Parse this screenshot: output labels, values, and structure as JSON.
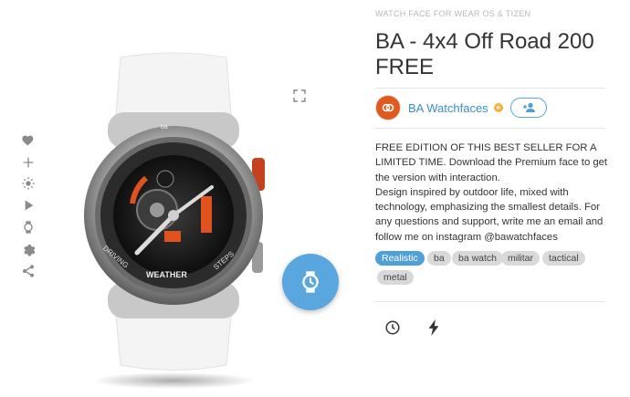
{
  "colors": {
    "accent": "#4f9fd8",
    "tag_bg": "#d9d9d9",
    "text": "#333333",
    "brand_orange": "#e05a1f"
  },
  "rail": [
    "heart-icon",
    "plus-icon",
    "brightness-icon",
    "play-icon",
    "watch-icon",
    "gear-icon",
    "share-icon"
  ],
  "watch": {
    "image_desc_label": "",
    "dial_labels": {
      "left": "DRIVING",
      "bottom": "WEATHER",
      "right": "STEPS"
    },
    "logo": "ba"
  },
  "details": {
    "category": "WATCH FACE FOR WEAR OS & TIZEN",
    "title": "BA - 4x4 Off Road 200 FREE",
    "author": "BA Watchfaces",
    "description": "FREE EDITION OF THIS BEST SELLER FOR A LIMITED TIME. Download the Premium face to get the version with interaction.\nDesign inspired by outdoor life, mixed with technology, emphasizing the smallest details. For any questions and support, write me an email and follow me on instagram @bawatchfaces",
    "tags": [
      "Realistic",
      "ba",
      "ba watch",
      "militar",
      "tactical",
      "metal"
    ],
    "active_tag": "Realistic"
  }
}
